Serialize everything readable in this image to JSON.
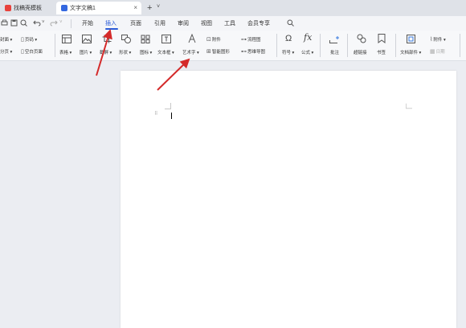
{
  "tabs": {
    "tab1_label": "找稿壳模板",
    "tab2_label": "文字文稿1",
    "close_symbol": "×",
    "new_tab_symbol": "+",
    "new_tab_menu_symbol": "˅"
  },
  "quick_access": {
    "icons": [
      "print-icon",
      "undo-icon",
      "redo-icon"
    ]
  },
  "menu": {
    "items": [
      "开始",
      "插入",
      "页面",
      "引用",
      "审阅",
      "视图",
      "工具",
      "会员专享"
    ],
    "active": "插入",
    "search_icon": "search-icon"
  },
  "ribbon": {
    "left_cut": {
      "line1": "封面 ▾",
      "line2": "分页 ▾"
    },
    "page_number": "页码 ▾",
    "blank_page": "空白页面",
    "table": "表格 ▾",
    "picture": "图片 ▾",
    "screenshot": "截屏 ▾",
    "shape": "形状 ▾",
    "icon": "图标 ▾",
    "textbox": "文本框 ▾",
    "wordart": "艺术字 ▾",
    "attachment_small": "附件",
    "smart_shape": "智能图形",
    "flowchart": "流程图",
    "mindmap": "思维导图",
    "symbol": "符号 ▾",
    "formula": "公式 ▾",
    "comment": "批注",
    "hyperlink": "超链接",
    "bookmark": "书签",
    "doc_parts": "文档部件 ▾",
    "attachment": "附件 ▾",
    "date": "日期"
  },
  "colors": {
    "accent": "#2a5bd7",
    "arrow": "#d42a2a",
    "tab1_icon": "#e8423c",
    "tab2_icon": "#3468e0"
  }
}
